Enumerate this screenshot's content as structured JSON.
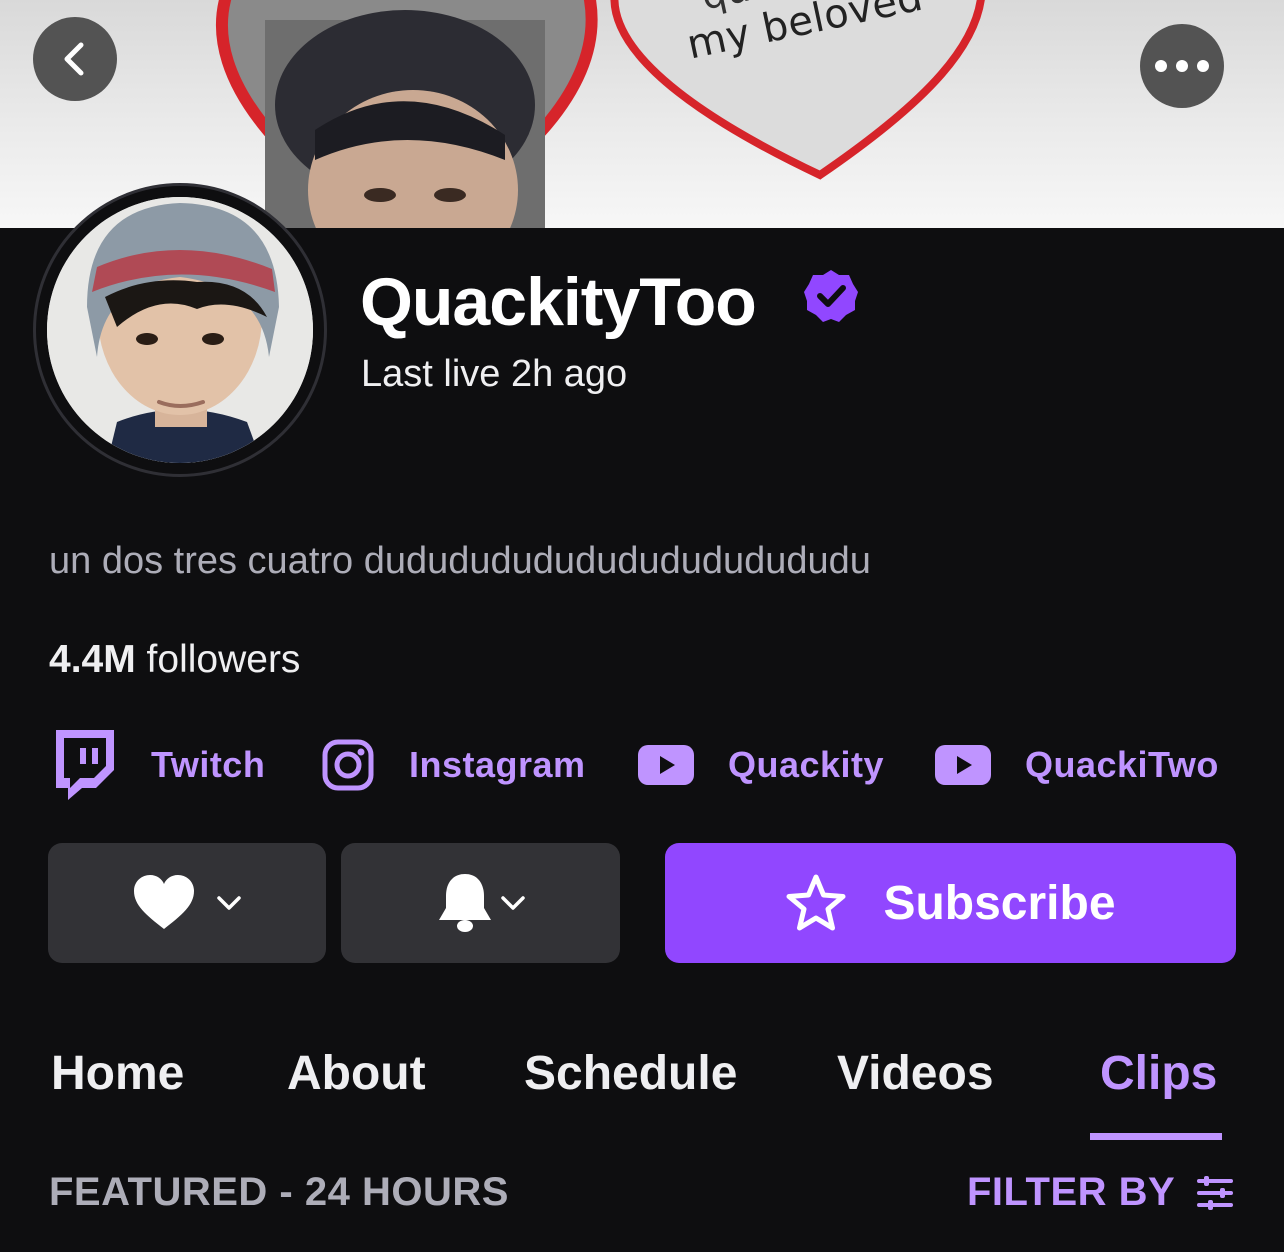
{
  "banner": {
    "text_line1": "quackity",
    "text_line2": "my beloved"
  },
  "icons": {
    "back": "chevron-left-icon",
    "more": "more-horizontal-icon",
    "verified": "verified-badge-icon",
    "twitch": "twitch-icon",
    "instagram": "instagram-icon",
    "youtube": "youtube-icon",
    "heart": "heart-icon",
    "bell": "bell-icon",
    "star": "star-icon",
    "filter": "filter-sliders-icon"
  },
  "colors": {
    "accent": "#9147ff",
    "accent_light": "#bf94ff",
    "background": "#0e0e10",
    "button_dark": "#323236"
  },
  "channel": {
    "name": "QuackityToo",
    "status": "Last live 2h ago",
    "bio": "un dos tres cuatro dudududududududududududu",
    "followers_count": "4.4M",
    "followers_label": " followers"
  },
  "social_links": [
    {
      "label": "Twitch"
    },
    {
      "label": "Instagram"
    },
    {
      "label": "Quackity"
    },
    {
      "label": "QuackiTwo"
    }
  ],
  "actions": {
    "subscribe_label": "Subscribe"
  },
  "tabs": [
    {
      "label": "Home"
    },
    {
      "label": "About"
    },
    {
      "label": "Schedule"
    },
    {
      "label": "Videos"
    },
    {
      "label": "Clips",
      "active": true
    }
  ],
  "clips_section": {
    "title": "FEATURED - 24 HOURS",
    "filter_label": "FILTER BY"
  }
}
